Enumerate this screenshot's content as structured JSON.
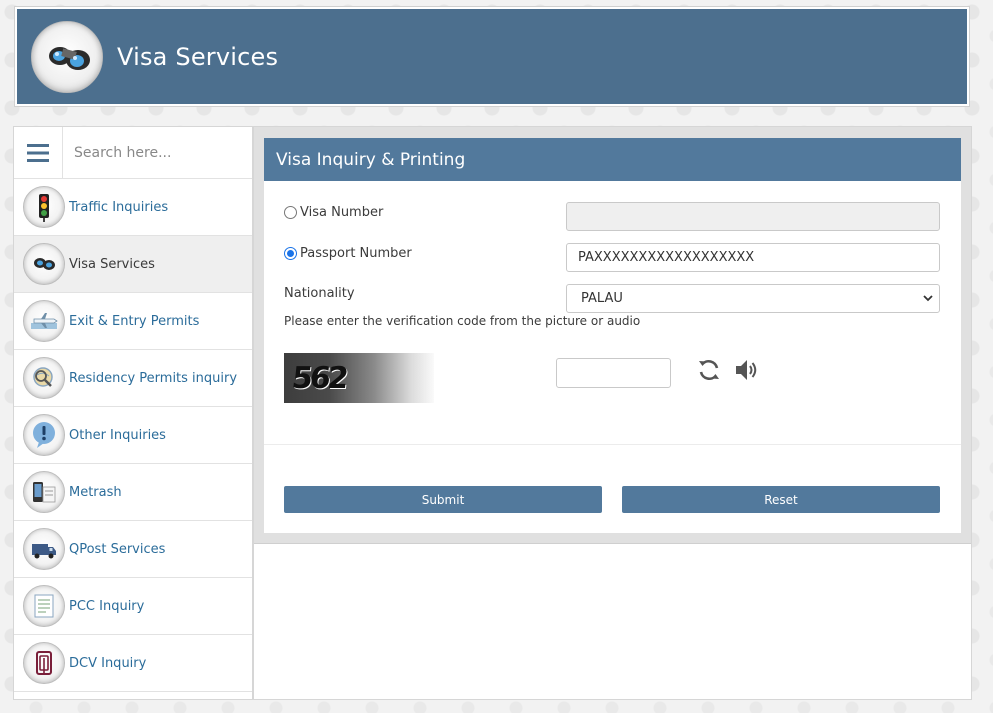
{
  "header": {
    "title": "Visa Services",
    "logo_icon": "binoculars-logo-icon"
  },
  "sidebar": {
    "search_placeholder": "Search here...",
    "menu_icon": "hamburger-menu-icon",
    "items": [
      {
        "label": "Traffic Inquiries",
        "icon": "traffic-light-icon",
        "active": false
      },
      {
        "label": "Visa Services",
        "icon": "binoculars-icon",
        "active": true
      },
      {
        "label": "Exit & Entry Permits",
        "icon": "airplane-icon",
        "active": false
      },
      {
        "label": "Residency Permits inquiry",
        "icon": "magnifier-globe-icon",
        "active": false
      },
      {
        "label": "Other Inquiries",
        "icon": "exclamation-bubble-icon",
        "active": false
      },
      {
        "label": "Metrash",
        "icon": "phone-card-icon",
        "active": false
      },
      {
        "label": "QPost Services",
        "icon": "delivery-truck-icon",
        "active": false
      },
      {
        "label": "PCC Inquiry",
        "icon": "certificate-icon",
        "active": false
      },
      {
        "label": "DCV Inquiry",
        "icon": "dcv-logo-icon",
        "active": false
      }
    ]
  },
  "panel": {
    "title": "Visa Inquiry & Printing",
    "visa_number_label": "Visa Number",
    "visa_number_value": "",
    "passport_number_label": "Passport Number",
    "passport_number_value": "PAXXXXXXXXXXXXXXXXXX",
    "nationality_label": "Nationality",
    "nationality_value": "PALAU",
    "selected_option": "Passport Number",
    "captcha_hint": "Please enter the verification code from the picture or audio",
    "captcha_text": "562",
    "captcha_input_value": "",
    "refresh_icon": "refresh-icon",
    "audio_icon": "speaker-icon",
    "submit_label": "Submit",
    "reset_label": "Reset"
  },
  "colors": {
    "header_bg": "#4c6f8e",
    "panel_head_bg": "#52799c",
    "button_bg": "#52799c",
    "link_color": "#2b6c9a"
  }
}
